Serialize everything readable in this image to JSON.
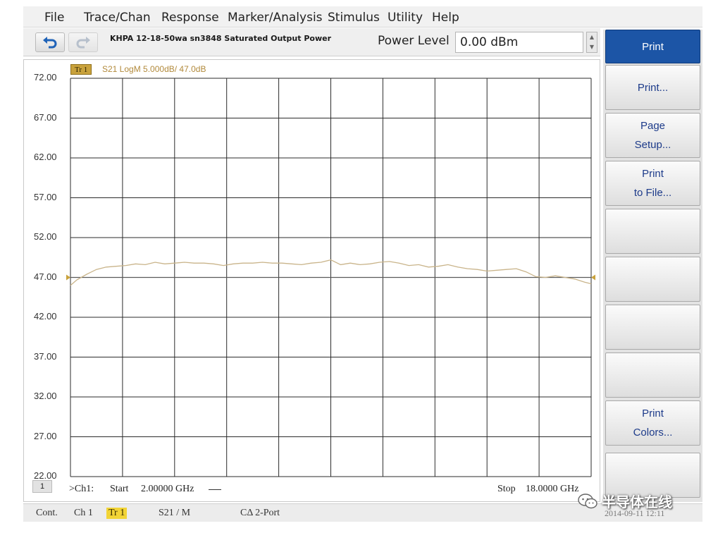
{
  "menu": [
    "File",
    "Trace/Chan",
    "Response",
    "Marker/Analysis",
    "Stimulus",
    "Utility",
    "Help"
  ],
  "toolbar": {
    "undo_icon": "undo-arrow-icon",
    "redo_icon": "redo-arrow-icon",
    "title": "KHPA 12-18-50wa sn3848 Saturated Output Power",
    "power_level_label": "Power Level",
    "power_level_value": "0.00 dBm"
  },
  "trace": {
    "tag": "Tr 1",
    "info": "S21 LogM 5.000dB/ 47.0dB",
    "color": "#c9a23c",
    "reference_value": 47.0
  },
  "plot": {
    "y_labels": [
      "72.00",
      "67.00",
      "62.00",
      "57.00",
      "52.00",
      "47.00",
      "42.00",
      "37.00",
      "32.00",
      "27.00",
      "22.00"
    ],
    "channel_number": "1",
    "channel_label": ">Ch1:",
    "start_label": "Start",
    "start_value": "2.00000 GHz",
    "stop_label": "Stop",
    "stop_value": "18.0000 GHz"
  },
  "chart_data": {
    "type": "line",
    "xlim": [
      2.0,
      18.0
    ],
    "ylim": [
      22.0,
      72.0
    ],
    "x_unit": "GHz",
    "y_unit": "dB",
    "grid": true,
    "series": [
      {
        "x": [
          2.0,
          2.2,
          2.5,
          2.8,
          3.1,
          3.4,
          3.7,
          4.0,
          4.3,
          4.6,
          4.9,
          5.2,
          5.5,
          5.8,
          6.1,
          6.4,
          6.7,
          7.0,
          7.3,
          7.6,
          7.9,
          8.2,
          8.5,
          8.8,
          9.1,
          9.4,
          9.7,
          10.0,
          10.3,
          10.6,
          10.9,
          11.2,
          11.5,
          11.8,
          12.1,
          12.4,
          12.7,
          13.0,
          13.3,
          13.6,
          13.9,
          14.2,
          14.5,
          14.8,
          15.1,
          15.4,
          15.7,
          16.0,
          16.3,
          16.6,
          16.9,
          17.2,
          17.5,
          17.8,
          18.0
        ],
        "y": [
          46.0,
          46.7,
          47.4,
          48.0,
          48.3,
          48.4,
          48.5,
          48.7,
          48.6,
          48.9,
          48.7,
          48.8,
          48.9,
          48.8,
          48.8,
          48.7,
          48.5,
          48.7,
          48.8,
          48.8,
          48.9,
          48.8,
          48.8,
          48.7,
          48.6,
          48.8,
          48.9,
          49.2,
          48.6,
          48.8,
          48.6,
          48.7,
          48.9,
          49.0,
          48.8,
          48.5,
          48.6,
          48.3,
          48.4,
          48.6,
          48.3,
          48.1,
          48.0,
          47.8,
          47.9,
          48.0,
          48.1,
          47.7,
          47.1,
          47.0,
          47.2,
          47.0,
          46.8,
          46.4,
          46.2
        ]
      }
    ]
  },
  "status": {
    "cont": "Cont.",
    "channel": "Ch 1",
    "trace": "Tr 1",
    "param": "S21 / M",
    "cal": "CΔ 2-Port",
    "time": "2014-09-11 12:11"
  },
  "softkeys": {
    "title": "Print",
    "items": [
      {
        "lines": [
          "Print..."
        ]
      },
      {
        "lines": [
          "Page",
          "Setup..."
        ]
      },
      {
        "lines": [
          "Print",
          "to File..."
        ]
      },
      {
        "lines": []
      },
      {
        "lines": []
      },
      {
        "lines": []
      },
      {
        "lines": []
      },
      {
        "lines": [
          "Print",
          "Colors..."
        ]
      },
      {
        "lines": []
      }
    ]
  },
  "watermark": {
    "text": "半导体在线",
    "icon": "wechat-icon"
  }
}
